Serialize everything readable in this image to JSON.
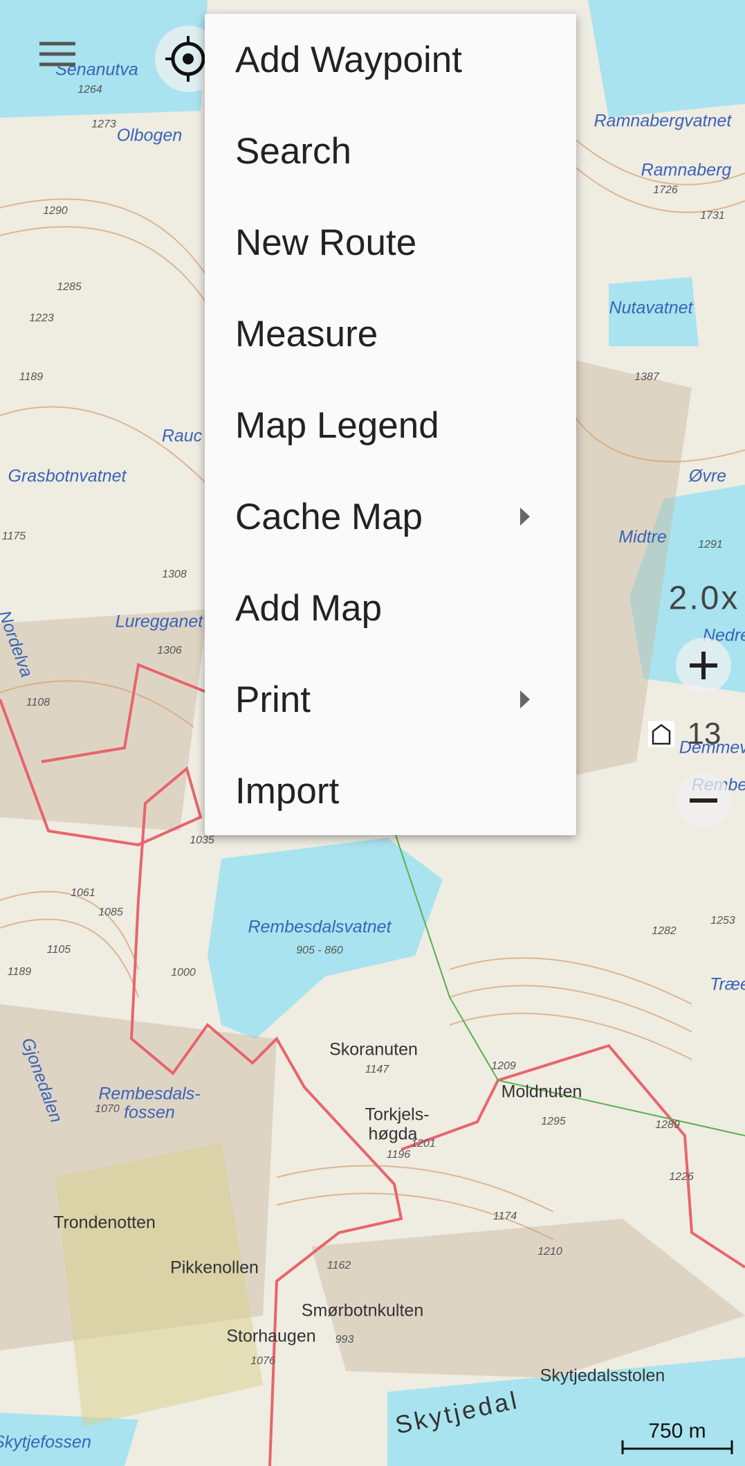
{
  "map": {
    "labels": [
      "Olbogen",
      "Ramnabergvatnet",
      "Ramnaberg",
      "Nutavatnet",
      "Grasbotnvatnet",
      "Øvre",
      "Midtre",
      "Luregganet",
      "Nordelva",
      "Rembesdalsvatnet",
      "905 - 860",
      "Skoranuten",
      "Moldnuten",
      "Torkjels-",
      "høgda",
      "Rembesdals-",
      "fossen",
      "Trondenotten",
      "Pikkenollen",
      "Smørbotnkulten",
      "Storhaugen",
      "Skytjedal",
      "Skytjedalsstolen",
      "Skytjefossen",
      "Senanutva",
      "Rembe",
      "Demmevas",
      "Nedre",
      "Gjonedalen",
      "Træe",
      "Rauc",
      "1273",
      "1264",
      "1290",
      "1285",
      "1223",
      "1189",
      "1175",
      "1308",
      "1306",
      "1108",
      "1061",
      "1085",
      "1105",
      "1189",
      "1000",
      "1070",
      "1147",
      "1209",
      "1295",
      "1289",
      "1226",
      "1174",
      "1210",
      "1162",
      "993",
      "1076",
      "1726",
      "1731",
      "1387",
      "1291",
      "1282",
      "1253",
      "1035",
      "1201",
      "1196"
    ],
    "colors": {
      "water": "#a9e3ef",
      "trail": "#e8646c",
      "contour": "#d4a070",
      "terrain": "#efece2"
    }
  },
  "controls": {
    "zoom_factor": "2.0x",
    "layer_level": "13",
    "scale": "750 m"
  },
  "menu": {
    "items": [
      {
        "label": "Add Waypoint",
        "submenu": false
      },
      {
        "label": "Search",
        "submenu": false
      },
      {
        "label": "New Route",
        "submenu": false
      },
      {
        "label": "Measure",
        "submenu": false
      },
      {
        "label": "Map Legend",
        "submenu": false
      },
      {
        "label": "Cache Map",
        "submenu": true
      },
      {
        "label": "Add Map",
        "submenu": false
      },
      {
        "label": "Print",
        "submenu": true
      },
      {
        "label": "Import",
        "submenu": false
      }
    ]
  }
}
